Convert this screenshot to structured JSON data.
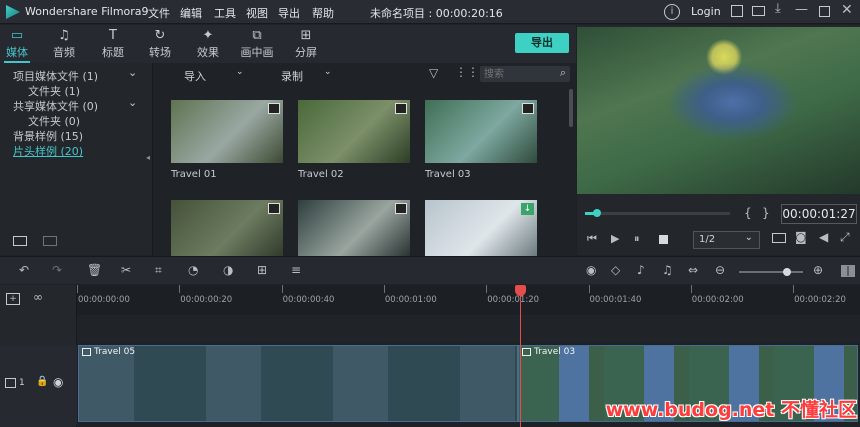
{
  "app": {
    "title": "Wondershare Filmora9",
    "project_title": "未命名项目 : 00:00:20:16",
    "login": "Login"
  },
  "menu": [
    "文件",
    "编辑",
    "工具",
    "视图",
    "导出",
    "帮助"
  ],
  "media_tabs": [
    {
      "label": "媒体",
      "icon": "folder-icon"
    },
    {
      "label": "音频",
      "icon": "music-note-icon"
    },
    {
      "label": "标题",
      "icon": "text-icon"
    },
    {
      "label": "转场",
      "icon": "transition-icon"
    },
    {
      "label": "效果",
      "icon": "effects-icon"
    },
    {
      "label": "画中画",
      "icon": "pip-icon"
    },
    {
      "label": "分屏",
      "icon": "split-screen-icon"
    }
  ],
  "export_label": "导出",
  "tree": [
    {
      "label": "项目媒体文件 (1)",
      "chev": "⌄"
    },
    {
      "label": "文件夹 (1)",
      "chev": ""
    },
    {
      "label": "共享媒体文件 (0)",
      "chev": "⌄"
    },
    {
      "label": "文件夹 (0)",
      "chev": ""
    },
    {
      "label": "背景样例 (15)",
      "chev": ""
    },
    {
      "label": "片头样例 (20)",
      "chev": ""
    }
  ],
  "media_toolbar": {
    "import": "导入",
    "record": "录制",
    "search_placeholder": "搜索"
  },
  "media_items": [
    {
      "label": "Travel 01",
      "colors": [
        "#5f7351",
        "#9aa8a3",
        "#3c4a32"
      ]
    },
    {
      "label": "Travel 02",
      "colors": [
        "#4a6a3a",
        "#7c8f69",
        "#2d3e25"
      ]
    },
    {
      "label": "Travel 03",
      "colors": [
        "#3f6f55",
        "#7ea8a0",
        "#2f4a3c"
      ]
    },
    {
      "label": "",
      "colors": [
        "#45523a",
        "#6d7c60",
        "#2b3426"
      ]
    },
    {
      "label": "",
      "colors": [
        "#2d3f3d",
        "#9aa5a0",
        "#1d2828"
      ]
    },
    {
      "label": "",
      "colors": [
        "#b7c4cc",
        "#dfe6ea",
        "#5f6f72"
      ]
    }
  ],
  "preview": {
    "timecode": "00:00:01:27",
    "zoom": "1/2",
    "progress": 0.08
  },
  "timeline": {
    "ticks": [
      "00:00:00:00",
      "00:00:00:20",
      "00:00:00:40",
      "00:00:01:00",
      "00:00:01:20",
      "00:00:01:40",
      "00:00:02:00",
      "00:00:02:20"
    ],
    "clips": [
      {
        "label": "Travel 05"
      },
      {
        "label": "Travel 03"
      }
    ],
    "track_number": "1",
    "zoom_level": 0.75
  },
  "watermark": "www.budog.net 不懂社区"
}
